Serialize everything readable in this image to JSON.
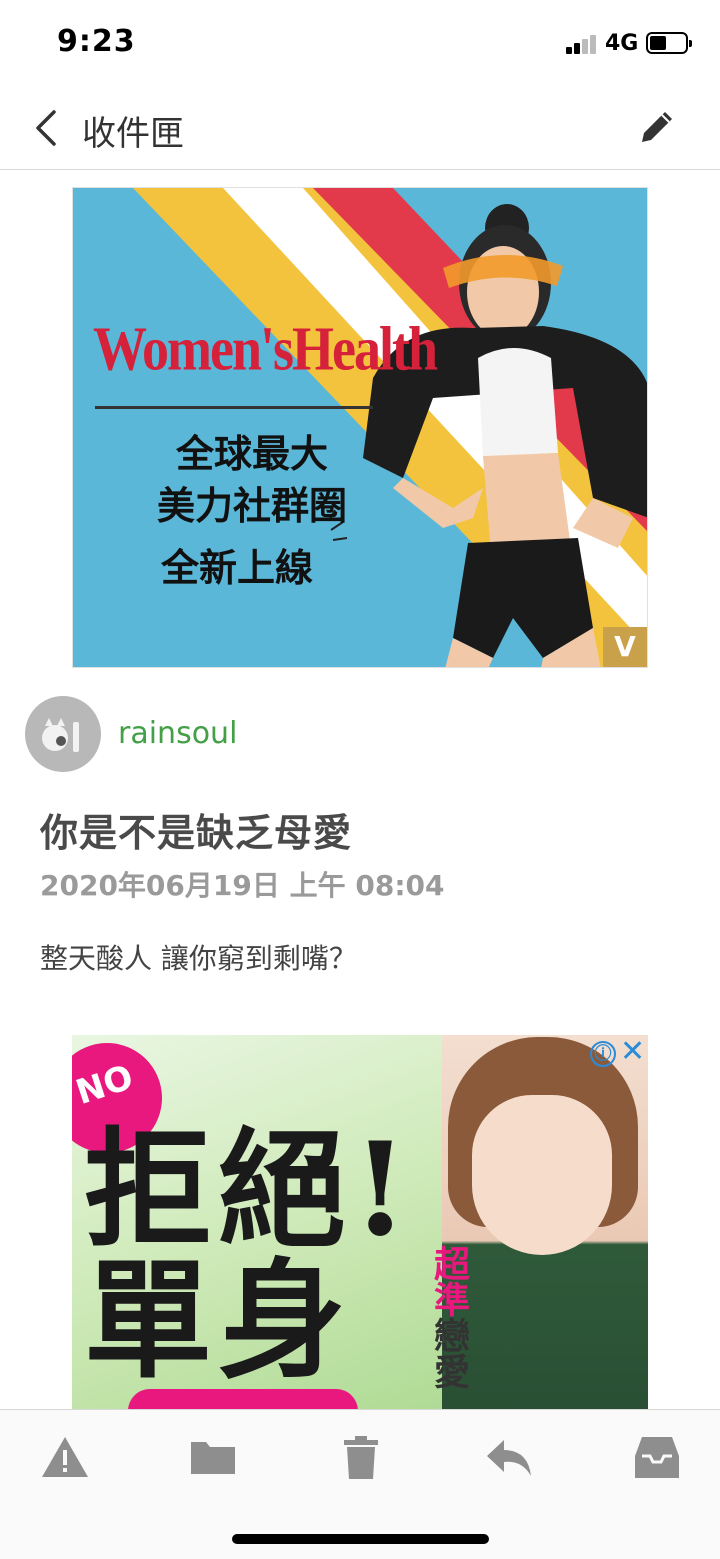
{
  "status_bar": {
    "time": "9:23",
    "network": "4G"
  },
  "nav": {
    "back_icon": "chevron-left-icon",
    "title": "收件匣",
    "edit_icon": "pencil-icon"
  },
  "ad_top": {
    "brand": "Women'sHealth",
    "slogan_line1": "全球最大",
    "slogan_line2": "美力社群圈",
    "slogan_line3": "全新上線",
    "badge": "V",
    "colors": {
      "sky": "#5bb7d8",
      "yellow": "#f3c33d",
      "white_stripe": "#ffffff",
      "red_stripe": "#e23a4a"
    }
  },
  "email": {
    "sender_icon": "avatar-icon",
    "sender": "rainsoul",
    "subject": "你是不是缺乏母愛",
    "date": "2020年06月19日 上午 08:04",
    "body": "整天酸人 讓你窮到剩嘴？"
  },
  "ad_bottom": {
    "tag": "NO",
    "headline_line1": "拒絕!",
    "headline_line2": "單身",
    "side_pink": "超準",
    "side_dark": "戀愛",
    "info_icon": "ⓘ",
    "close_icon": "✕"
  },
  "toolbar": {
    "items": [
      {
        "name": "report-spam",
        "icon": "warning-icon"
      },
      {
        "name": "move-to-folder",
        "icon": "folder-icon"
      },
      {
        "name": "delete",
        "icon": "trash-icon"
      },
      {
        "name": "reply",
        "icon": "reply-icon"
      },
      {
        "name": "inbox",
        "icon": "inbox-icon"
      }
    ]
  }
}
